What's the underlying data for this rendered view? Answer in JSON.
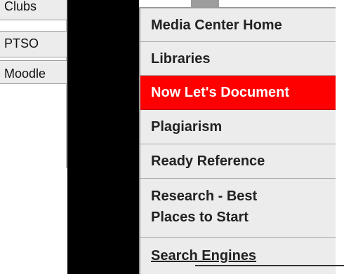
{
  "left_nav": {
    "items": [
      {
        "label": "Clubs"
      },
      {
        "label": "PTSO"
      },
      {
        "label": "Moodle"
      }
    ]
  },
  "flyout_menu": {
    "active_color": "#ff0000",
    "items": [
      {
        "label": "Media Center Home",
        "active": false
      },
      {
        "label": "Libraries",
        "active": false
      },
      {
        "label": "Now Let's Document",
        "active": true
      },
      {
        "label": "Plagiarism",
        "active": false
      },
      {
        "label": "Ready Reference",
        "active": false
      },
      {
        "label": "Research - Best Places to Start",
        "active": false
      },
      {
        "label": "Search Engines",
        "active": false
      }
    ]
  }
}
